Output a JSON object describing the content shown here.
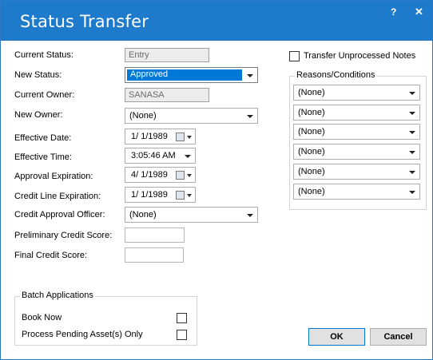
{
  "window": {
    "title": "Status Transfer",
    "help_glyph": "?",
    "close_glyph": "✕"
  },
  "form": {
    "current_status": {
      "label": "Current Status:",
      "value": "Entry"
    },
    "new_status": {
      "label": "New Status:",
      "value": "Approved"
    },
    "current_owner": {
      "label": "Current Owner:",
      "value": "SANASA"
    },
    "new_owner": {
      "label": "New Owner:",
      "value": "(None)"
    },
    "effective_date": {
      "label": "Effective Date:",
      "value": "1/  1/1989"
    },
    "effective_time": {
      "label": "Effective Time:",
      "value": "3:05:46 AM"
    },
    "approval_expiration": {
      "label": "Approval Expiration:",
      "value": "4/  1/1989"
    },
    "credit_line_expiration": {
      "label": "Credit Line Expiration:",
      "value": "1/  1/1989"
    },
    "credit_approval_officer": {
      "label": "Credit Approval Officer:",
      "value": "(None)"
    },
    "preliminary_credit_score": {
      "label": "Preliminary Credit Score:",
      "value": ""
    },
    "final_credit_score": {
      "label": "Final Credit Score:",
      "value": ""
    }
  },
  "transfer_notes": {
    "label": "Transfer Unprocessed Notes",
    "checked": false
  },
  "reasons": {
    "legend": "Reasons/Conditions",
    "items": [
      "(None)",
      "(None)",
      "(None)",
      "(None)",
      "(None)",
      "(None)"
    ]
  },
  "batch": {
    "legend": "Batch Applications",
    "book_now": {
      "label": "Book Now",
      "checked": false
    },
    "process_pending": {
      "label": "Process Pending Asset(s) Only",
      "checked": false
    }
  },
  "buttons": {
    "ok": "OK",
    "cancel": "Cancel"
  }
}
